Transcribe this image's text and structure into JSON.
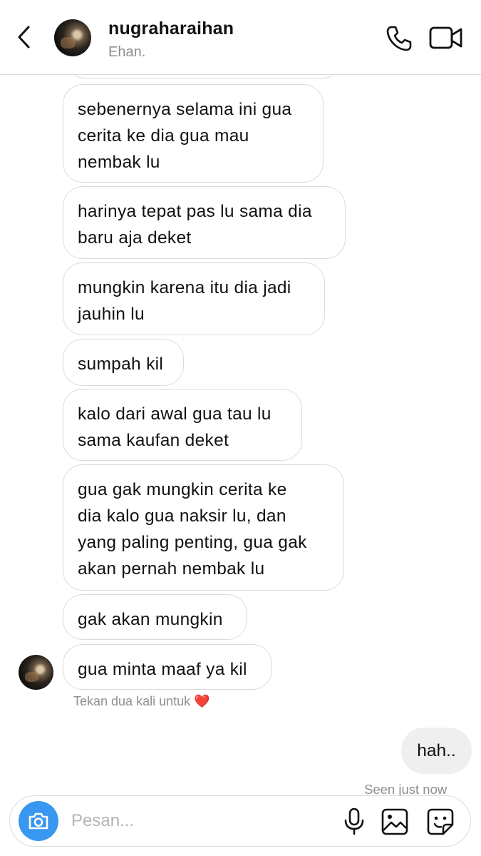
{
  "header": {
    "username": "nugraharaihan",
    "subtitle": "Ehan.",
    "icons": [
      "back-chevron-icon",
      "phone-icon",
      "video-camera-icon"
    ]
  },
  "messages": [
    {
      "from": "them",
      "text": "sebenernya selama ini gua\ncerita ke dia gua mau\nnembak lu"
    },
    {
      "from": "them",
      "text": "harinya tepat pas lu sama dia\nbaru aja deket"
    },
    {
      "from": "them",
      "text": "mungkin karena itu dia jadi\njauhin lu"
    },
    {
      "from": "them",
      "text": "sumpah kil"
    },
    {
      "from": "them",
      "text": "kalo dari awal gua tau lu\nsama kaufan deket"
    },
    {
      "from": "them",
      "text": "gua gak mungkin cerita ke\ndia kalo gua naksir lu, dan\nyang paling penting, gua gak\nakan pernah nembak lu"
    },
    {
      "from": "them",
      "text": "gak akan mungkin"
    },
    {
      "from": "them",
      "text": "gua minta maaf ya kil"
    }
  ],
  "double_tap_hint": "Tekan dua kali untuk",
  "hint_emoji": "❤️",
  "sent_message": "hah..",
  "seen_status": "Seen just now",
  "composer": {
    "placeholder": "Pesan...",
    "icons": [
      "camera-icon",
      "microphone-icon",
      "gallery-icon",
      "sticker-icon"
    ],
    "accent_color": "#3897f0"
  }
}
